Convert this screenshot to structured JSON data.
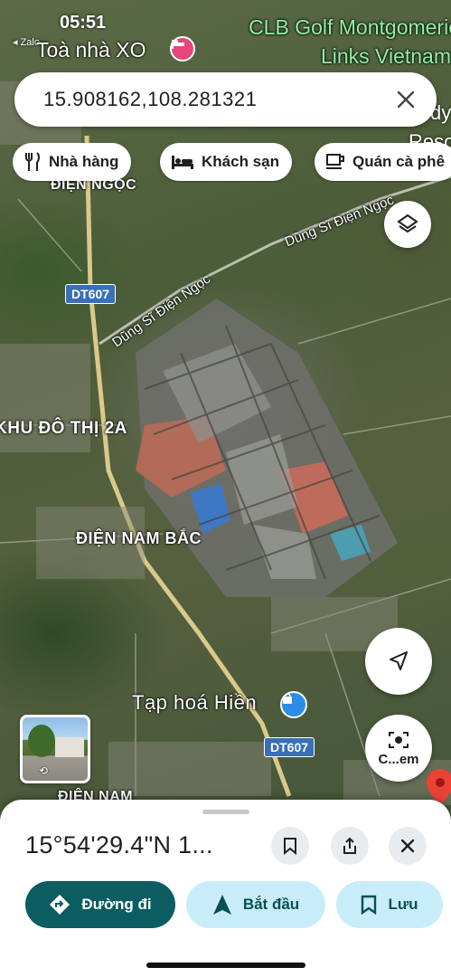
{
  "status_bar": {
    "time": "05:51",
    "back_app": "◂ Zalo"
  },
  "map": {
    "pois": {
      "toa_nha": "Toà nhà XO",
      "golf_line1": "CLB Golf Montgomerie",
      "golf_line2": "Links Vietnam",
      "right_partial_1": "dy",
      "right_partial_2": "Reso",
      "tap_hoa": "Tạp hoá Hiền"
    },
    "areas": {
      "dien_ngoc": "ĐIỆN NGỌC",
      "khu_do_thi": "KHU ĐÔ THỊ 2A",
      "dien_nam_bac": "ĐIỆN NAM BẮC",
      "dien_nam": "ĐIỆN NAM"
    },
    "roads": {
      "dung_si_1": "Dũng Sĩ Điện Ngọc",
      "dung_si_2": "Dũng Sĩ Điện Ngọc",
      "dt607_top": "DT607",
      "dt607_bottom": "DT607"
    }
  },
  "search": {
    "query": "15.908162,108.281321"
  },
  "chips": [
    {
      "label": "Nhà hàng",
      "icon": "restaurant-icon"
    },
    {
      "label": "Khách sạn",
      "icon": "hotel-icon"
    },
    {
      "label": "Quán cà phê",
      "icon": "coffee-icon"
    }
  ],
  "controls": {
    "lens_label": "C...em"
  },
  "sheet": {
    "coordinates": "15°54'29.4\"N 1...",
    "actions": {
      "directions": "Đường đi",
      "start": "Bắt đầu",
      "save": "Lưu"
    }
  },
  "colors": {
    "accent": "#0b5d61",
    "tonal": "#c8edf8",
    "pin": "#ea4335",
    "golf_label": "#8ff0a4"
  }
}
